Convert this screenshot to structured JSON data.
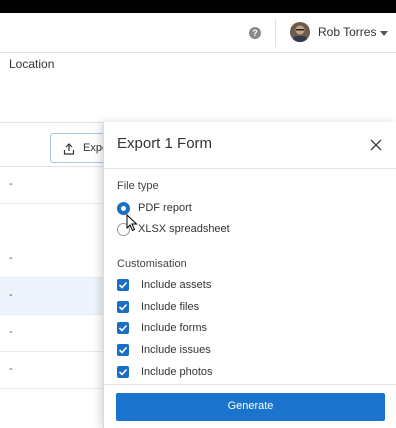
{
  "header": {
    "help_icon_glyph": "?",
    "user_name": "Rob Torres"
  },
  "background_table": {
    "column_header": "Location",
    "rows": [
      "-",
      "-",
      "-",
      "-",
      "-"
    ]
  },
  "toolbar": {
    "export_label": "Expo"
  },
  "export_panel": {
    "title": "Export 1 Form",
    "file_type_label": "File type",
    "file_types": [
      {
        "label": "PDF report",
        "selected": true
      },
      {
        "label": "XLSX spreadsheet",
        "selected": false
      }
    ],
    "customisation_label": "Customisation",
    "options": [
      {
        "label": "Include assets",
        "checked": true
      },
      {
        "label": "Include files",
        "checked": true
      },
      {
        "label": "Include forms",
        "checked": true
      },
      {
        "label": "Include issues",
        "checked": true
      },
      {
        "label": "Include photos",
        "checked": true
      }
    ],
    "generate_label": "Generate"
  },
  "colors": {
    "accent": "#1a73cc",
    "checkbox": "#1a6fc4",
    "row_highlight": "#eef4fb"
  }
}
